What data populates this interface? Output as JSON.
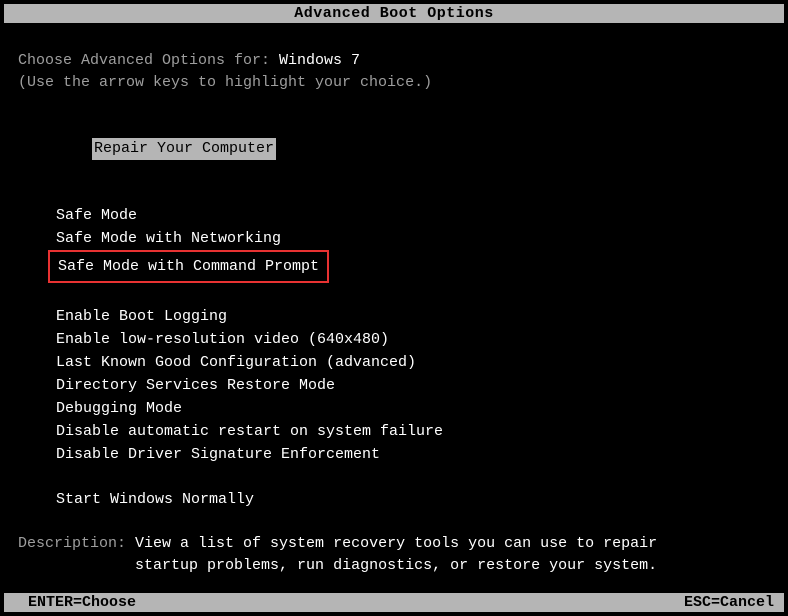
{
  "title": "Advanced Boot Options",
  "prompt_prefix": "Choose Advanced Options for: ",
  "os_name": "Windows 7",
  "instruction": "(Use the arrow keys to highlight your choice.)",
  "selected_option": "Repair Your Computer",
  "group1": [
    "Safe Mode",
    "Safe Mode with Networking",
    "Safe Mode with Command Prompt"
  ],
  "group2": [
    "Enable Boot Logging",
    "Enable low-resolution video (640x480)",
    "Last Known Good Configuration (advanced)",
    "Directory Services Restore Mode",
    "Debugging Mode",
    "Disable automatic restart on system failure",
    "Disable Driver Signature Enforcement"
  ],
  "group3": [
    "Start Windows Normally"
  ],
  "boxed_option": "Safe Mode with Command Prompt",
  "description_label": "Description: ",
  "description_line1": "View a list of system recovery tools you can use to repair",
  "description_line2": "startup problems, run diagnostics, or restore your system.",
  "footer_left": "ENTER=Choose",
  "footer_right": "ESC=Cancel"
}
